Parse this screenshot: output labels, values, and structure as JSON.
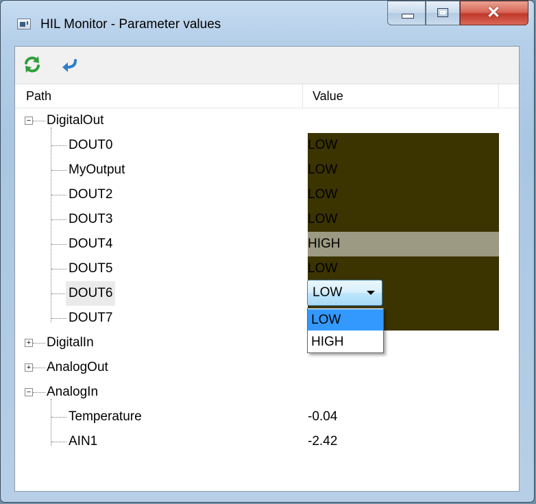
{
  "window": {
    "title": "HIL Monitor - Parameter values",
    "controls": {
      "minimize": "minimize",
      "maximize": "maximize",
      "close": "x"
    }
  },
  "toolbar": {
    "buttons": [
      {
        "icon": "refresh-icon",
        "color": "#2e9e3b"
      },
      {
        "icon": "return-arrow-icon",
        "color": "#2f7fc9"
      }
    ]
  },
  "table": {
    "columns": {
      "path": "Path",
      "value": "Value"
    }
  },
  "tree": {
    "groups": [
      {
        "name": "DigitalOut",
        "expanded": true,
        "items": [
          {
            "name": "DOUT0",
            "value": "LOW"
          },
          {
            "name": "MyOutput",
            "value": "LOW"
          },
          {
            "name": "DOUT2",
            "value": "LOW"
          },
          {
            "name": "DOUT3",
            "value": "LOW"
          },
          {
            "name": "DOUT4",
            "value": "HIGH"
          },
          {
            "name": "DOUT5",
            "value": "LOW"
          },
          {
            "name": "DOUT6",
            "value": "LOW",
            "editing": true
          },
          {
            "name": "DOUT7",
            "value": ""
          }
        ]
      },
      {
        "name": "DigitalIn",
        "expanded": false
      },
      {
        "name": "AnalogOut",
        "expanded": false
      },
      {
        "name": "AnalogIn",
        "expanded": true,
        "items": [
          {
            "name": "Temperature",
            "value": "-0.04"
          },
          {
            "name": "AIN1",
            "value": "-2.42"
          }
        ]
      }
    ]
  },
  "dropdown": {
    "selected": "LOW",
    "options": [
      "LOW",
      "HIGH"
    ],
    "highlighted": "LOW"
  },
  "colors": {
    "low_bg": "#3b3300",
    "high_bg": "#9c9a82",
    "dropdown_highlight": "#3399ff",
    "combo_border": "#3c7fb1"
  }
}
